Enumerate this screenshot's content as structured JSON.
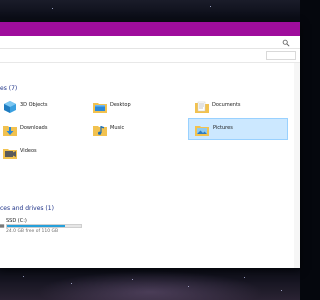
{
  "window": {
    "title_bar_color": "#9f0d9c"
  },
  "groups": {
    "folders_header": "es (7)",
    "drives_header": "ces and drives (1)"
  },
  "folders": [
    {
      "label": "3D Objects",
      "icon": "3d-objects-folder-icon",
      "selected": false
    },
    {
      "label": "Desktop",
      "icon": "desktop-folder-icon",
      "selected": false
    },
    {
      "label": "Documents",
      "icon": "documents-folder-icon",
      "selected": false
    },
    {
      "label": "Downloads",
      "icon": "downloads-folder-icon",
      "selected": false
    },
    {
      "label": "Music",
      "icon": "music-folder-icon",
      "selected": false
    },
    {
      "label": "Pictures",
      "icon": "pictures-folder-icon",
      "selected": true
    },
    {
      "label": "Videos",
      "icon": "videos-folder-icon",
      "selected": false
    }
  ],
  "drive": {
    "name": "SSD (C:)",
    "free_text": "24.0 GB free of 110 GB",
    "used_fraction": 0.78,
    "bar_color": "#26a0da"
  },
  "colors": {
    "accent": "#9f0d9c",
    "header_text": "#1e3287",
    "selection": "#cce8ff"
  }
}
